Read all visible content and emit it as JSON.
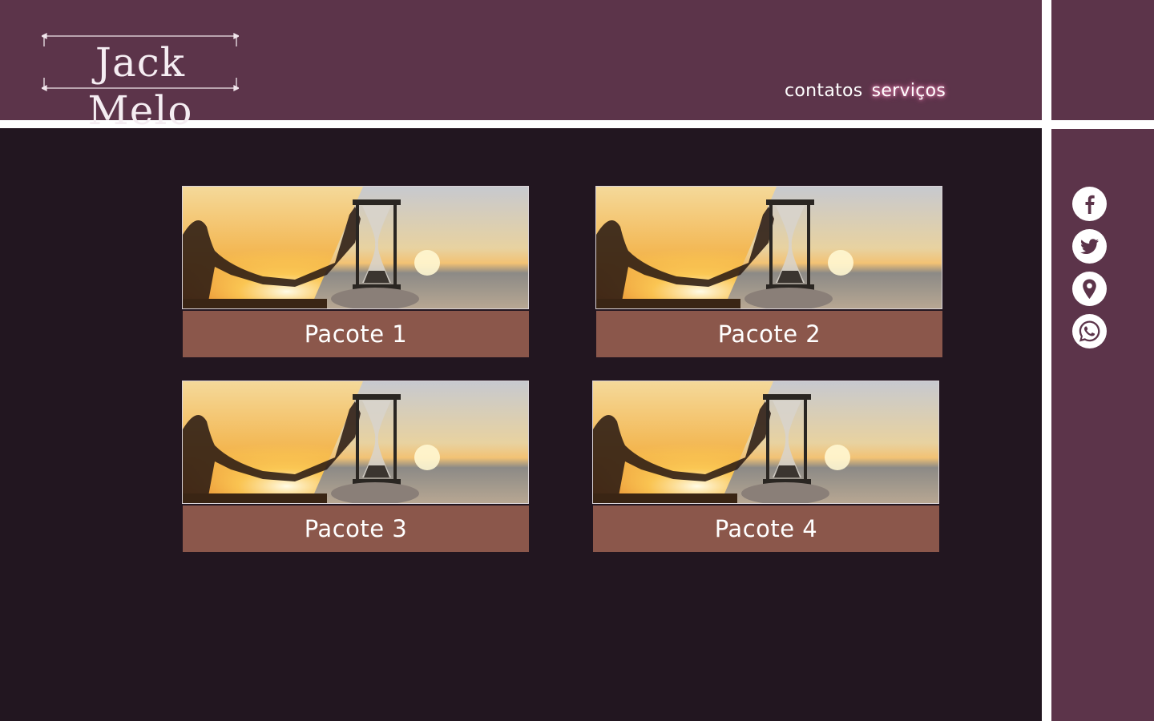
{
  "brand": {
    "name": "Jack Melo"
  },
  "nav": {
    "items": [
      {
        "label": "contatos"
      },
      {
        "label": "serviços"
      }
    ],
    "active": "serviços"
  },
  "packages": [
    {
      "label": "Pacote 1"
    },
    {
      "label": "Pacote 2"
    },
    {
      "label": "Pacote 3"
    },
    {
      "label": "Pacote 4"
    }
  ],
  "social": [
    {
      "icon": "facebook-icon"
    },
    {
      "icon": "twitter-icon"
    },
    {
      "icon": "location-pin-icon"
    },
    {
      "icon": "whatsapp-icon"
    }
  ],
  "colors": {
    "header": "#5c344a",
    "background": "#221620",
    "card_label": "#8b574b",
    "nav_active_glow": "#c56f96"
  }
}
